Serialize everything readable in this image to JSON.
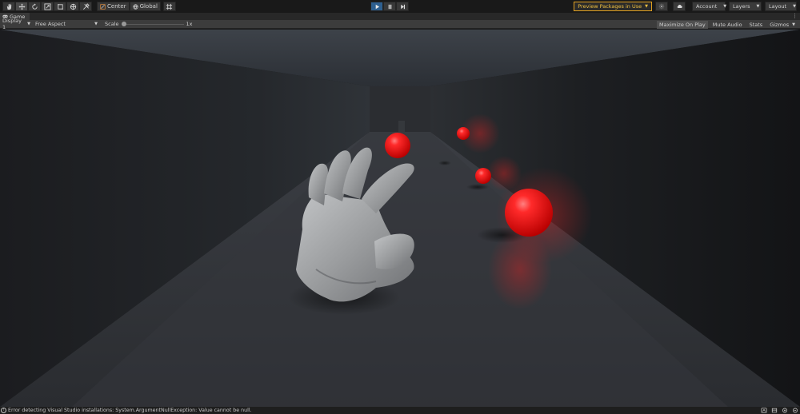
{
  "toolbar": {
    "tools": [
      "hand-tool",
      "move-tool",
      "rotate-tool",
      "scale-tool",
      "rect-tool",
      "transform-tool",
      "custom-tool"
    ],
    "pivot_label": "Center",
    "space_label": "Global",
    "preview_packages_label": "Preview Packages in Use",
    "account_label": "Account",
    "layers_label": "Layers",
    "layout_label": "Layout"
  },
  "tab": {
    "title": "Game"
  },
  "gamebar": {
    "display": "Display 1",
    "aspect": "Free Aspect",
    "scale_label": "Scale",
    "scale_value": "1x",
    "scale_fraction": 0.0,
    "maximize_on_play": "Maximize On Play",
    "mute_audio": "Mute Audio",
    "stats": "Stats",
    "gizmos": "Gizmos"
  },
  "status": {
    "message": "Error detecting Visual Studio installations: System.ArgumentNullException: Value cannot be null."
  },
  "colors": {
    "accent_play": "#2e5f8f",
    "preview_warning": "#e0a020",
    "sphere_red": "#ff1a1a",
    "hand_gray": "#9a9c9e"
  }
}
